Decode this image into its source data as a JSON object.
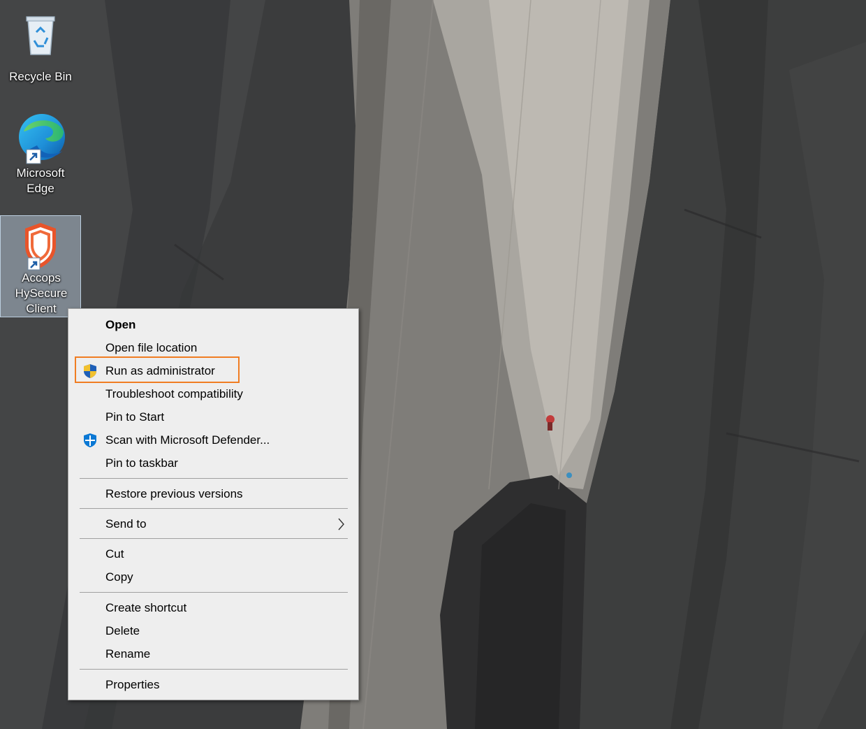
{
  "desktop_icons": {
    "recycle_bin": {
      "label": "Recycle Bin",
      "icon": "recycle-bin-icon"
    },
    "edge": {
      "label": "Microsoft\nEdge",
      "icon": "edge-icon"
    },
    "accops": {
      "label": "Accops\nHySecure\nClient",
      "icon": "accops-shield-icon"
    }
  },
  "context_menu": {
    "items": [
      {
        "label": "Open",
        "bold": true
      },
      {
        "label": "Open file location"
      },
      {
        "label": "Run as administrator",
        "icon": "uac-shield-icon",
        "highlighted": true
      },
      {
        "label": "Troubleshoot compatibility"
      },
      {
        "label": "Pin to Start"
      },
      {
        "label": "Scan with Microsoft Defender...",
        "icon": "defender-icon"
      },
      {
        "label": "Pin to taskbar"
      },
      {
        "label": "Restore previous versions"
      },
      {
        "label": "Send to",
        "submenu": true
      },
      {
        "label": "Cut"
      },
      {
        "label": "Copy"
      },
      {
        "label": "Create shortcut"
      },
      {
        "label": "Delete"
      },
      {
        "label": "Rename"
      },
      {
        "label": "Properties"
      }
    ]
  },
  "colors": {
    "highlight_outline": "#f07d22",
    "menu_background": "#eeeeee",
    "accops_shield": "#e8542a"
  }
}
